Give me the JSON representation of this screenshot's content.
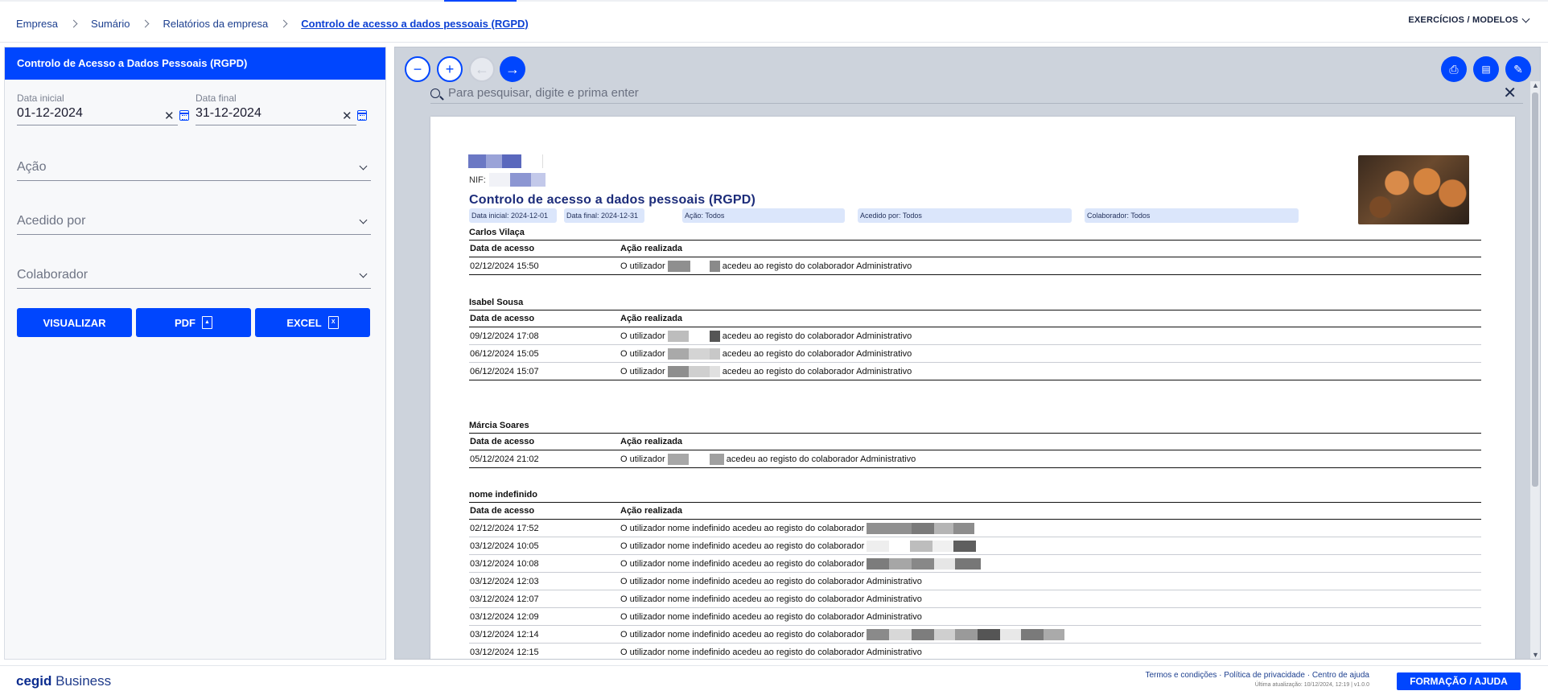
{
  "breadcrumb": {
    "items": [
      "Empresa",
      "Sumário",
      "Relatórios da empresa"
    ],
    "current": "Controlo de acesso a dados pessoais (RGPD)"
  },
  "header": {
    "exercises_menu": "EXERCÍCIOS / MODELOS"
  },
  "panel": {
    "title": "Controlo de Acesso a Dados Pessoais (RGPD)",
    "start_date": {
      "label": "Data inicial",
      "value": "01-12-2024"
    },
    "end_date": {
      "label": "Data final",
      "value": "31-12-2024"
    },
    "action": {
      "placeholder": "Ação"
    },
    "accessed_by": {
      "placeholder": "Acedido por"
    },
    "employee": {
      "placeholder": "Colaborador"
    },
    "buttons": {
      "view": "VISUALIZAR",
      "pdf": "PDF",
      "excel": "EXCEL"
    }
  },
  "viewer": {
    "search_placeholder": "Para pesquisar, digite e prima enter",
    "icons": {
      "zoom_out": "minus-icon",
      "zoom_in": "plus-icon",
      "back": "arrow-left-icon",
      "forward": "arrow-right-icon",
      "print": "printer-icon",
      "pdf": "pdf-file-icon",
      "edit": "edit-icon"
    }
  },
  "report": {
    "nif_label": "NIF:",
    "title": "Controlo de acesso a dados pessoais (RGPD)",
    "filters": [
      "Data inicial: 2024-12-01",
      "Data final: 2024-12-31",
      "Ação: Todos",
      "Acedido por: Todos",
      "Colaborador: Todos"
    ],
    "col_date": "Data de acesso",
    "col_action": "Ação realizada",
    "groups": [
      {
        "name": "Carlos Vilaça",
        "rows": [
          {
            "date": "02/12/2024 15:50",
            "pre": "O utilizador",
            "post": "acedeu ao registo do colaborador Administrativo"
          }
        ]
      },
      {
        "name": "Isabel Sousa",
        "rows": [
          {
            "date": "09/12/2024 17:08",
            "pre": "O utilizador",
            "post": "acedeu ao registo do colaborador Administrativo"
          },
          {
            "date": "06/12/2024 15:05",
            "pre": "O utilizador",
            "post": "acedeu ao registo do colaborador Administrativo"
          },
          {
            "date": "06/12/2024 15:07",
            "pre": "O utilizador",
            "post": "acedeu ao registo do colaborador Administrativo"
          }
        ]
      },
      {
        "name": "Márcia Soares",
        "rows": [
          {
            "date": "05/12/2024 21:02",
            "pre": "O utilizador",
            "post": "acedeu ao registo do colaborador Administrativo"
          }
        ]
      },
      {
        "name": "nome indefinido",
        "rows": [
          {
            "date": "02/12/2024 17:52",
            "pre": "O utilizador nome indefinido acedeu ao registo do colaborador",
            "post": ""
          },
          {
            "date": "03/12/2024 10:05",
            "pre": "O utilizador nome indefinido acedeu ao registo do colaborador",
            "post": ""
          },
          {
            "date": "03/12/2024 10:08",
            "pre": "O utilizador nome indefinido acedeu ao registo do colaborador",
            "post": ""
          },
          {
            "date": "03/12/2024 12:03",
            "pre": "O utilizador nome indefinido acedeu ao registo do colaborador Administrativo",
            "post": ""
          },
          {
            "date": "03/12/2024 12:07",
            "pre": "O utilizador nome indefinido acedeu ao registo do colaborador Administrativo",
            "post": ""
          },
          {
            "date": "03/12/2024 12:09",
            "pre": "O utilizador nome indefinido acedeu ao registo do colaborador Administrativo",
            "post": ""
          },
          {
            "date": "03/12/2024 12:14",
            "pre": "O utilizador nome indefinido acedeu ao registo do colaborador",
            "post": ""
          },
          {
            "date": "03/12/2024 12:15",
            "pre": "O utilizador nome indefinido acedeu ao registo do colaborador Administrativo",
            "post": ""
          }
        ]
      }
    ]
  },
  "footer": {
    "brand_bold": "cegid",
    "brand_light": "Business",
    "links": [
      "Termos e condições",
      "Política de privacidade",
      "Centro de ajuda"
    ],
    "link_separator": "·",
    "last_update": "Última atualização: 10/12/2024, 12:19 | v1.0.0",
    "help_button": "FORMAÇÃO / AJUDA"
  },
  "colors": {
    "accent": "#0046fe",
    "panel_bg": "#f7f8fa",
    "viewer_bg": "#cdd3dc",
    "pill_bg": "#dbe6fb",
    "title_blue": "#1c2c7a"
  }
}
